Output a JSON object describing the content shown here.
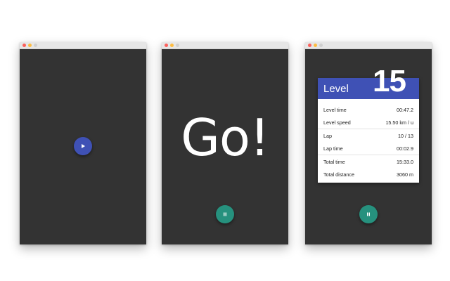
{
  "colors": {
    "background": "#ffffff",
    "window_bg": "#333333",
    "titlebar": "#e6e6e6",
    "close_dot": "#fc605c",
    "minimize_dot": "#fdbc40",
    "zoom_dot": "#cfcfcf",
    "play_button": "#3f51b5",
    "pause_button": "#26917e",
    "card_header": "#3f51b5",
    "text_light": "#ffffff",
    "text_dark": "#222222"
  },
  "windows": [
    {
      "id": "start-screen",
      "controls": {
        "button_icon": "play-icon"
      }
    },
    {
      "id": "countdown-screen",
      "headline": "Go!",
      "controls": {
        "button_icon": "pause-icon"
      }
    },
    {
      "id": "level-stats-screen",
      "level": {
        "title": "Level",
        "number": "15"
      },
      "stats": [
        {
          "label": "Level time",
          "value": "00:47.2"
        },
        {
          "label": "Level speed",
          "value": "15.50 km / u"
        },
        {
          "label": "Lap",
          "value": "10 / 13"
        },
        {
          "label": "Lap time",
          "value": "00:02.9"
        },
        {
          "label": "Total time",
          "value": "15:33.0"
        },
        {
          "label": "Total distance",
          "value": "3060 m"
        }
      ],
      "controls": {
        "button_icon": "pause-icon"
      }
    }
  ]
}
